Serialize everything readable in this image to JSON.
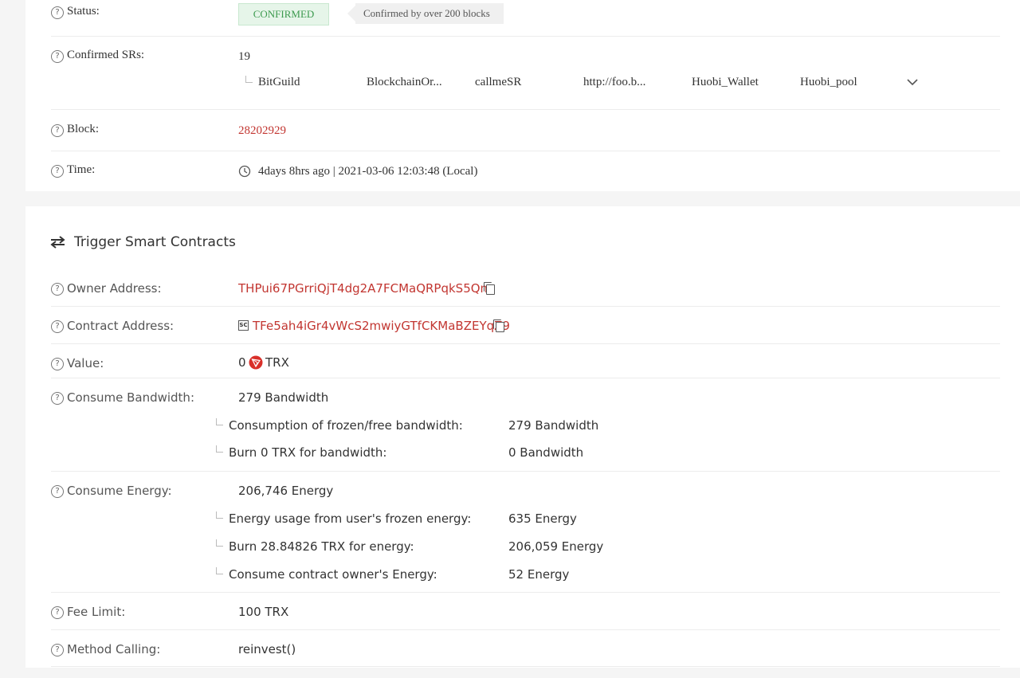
{
  "overview": {
    "status": {
      "label": "Status:",
      "badge": "CONFIRMED",
      "tip": "Confirmed by over 200 blocks"
    },
    "confirmed_srs": {
      "label": "Confirmed SRs:",
      "count": "19",
      "names": [
        "BitGuild",
        "BlockchainOr...",
        "callmeSR",
        "http://foo.b...",
        "Huobi_Wallet",
        "Huobi_pool"
      ]
    },
    "block": {
      "label": "Block:",
      "value": "28202929"
    },
    "time": {
      "label": "Time:",
      "value": "4days 8hrs ago | 2021-03-06 12:03:48 (Local)"
    }
  },
  "contract": {
    "title": "Trigger Smart Contracts",
    "owner_address": {
      "label": "Owner Address:",
      "value": "THPui67PGrriQjT4dg2A7FCMaQRPqkS5Qm"
    },
    "contract_address": {
      "label": "Contract Address:",
      "badge": "SC",
      "value": "TFe5ah4iGr4vWcS2mwiyGTfCKMaBZEYqZ9"
    },
    "value": {
      "label": "Value:",
      "amount": "0",
      "unit": "TRX"
    },
    "bandwidth": {
      "label": "Consume Bandwidth:",
      "value": "279 Bandwidth",
      "items": [
        {
          "label": "Consumption of frozen/free bandwidth:",
          "value": "279 Bandwidth"
        },
        {
          "label": "Burn 0 TRX for bandwidth:",
          "value": "0 Bandwidth"
        }
      ]
    },
    "energy": {
      "label": "Consume Energy:",
      "value": "206,746 Energy",
      "items": [
        {
          "label": "Energy usage from user's frozen energy:",
          "value": "635 Energy"
        },
        {
          "label": "Burn 28.84826 TRX for energy:",
          "value": "206,059 Energy"
        },
        {
          "label": "Consume contract owner's Energy:",
          "value": "52 Energy"
        }
      ]
    },
    "fee_limit": {
      "label": "Fee Limit:",
      "value": "100 TRX"
    },
    "method": {
      "label": "Method Calling:",
      "value": "reinvest()"
    }
  },
  "colors": {
    "link": "#c23631",
    "confirmed_bg": "#e6f5e9",
    "confirmed_text": "#3c9a4e",
    "trx": "#d9302a"
  },
  "icons": [
    "help-icon",
    "clock-icon",
    "transfer-arrows-icon",
    "copy-icon",
    "chevron-down-icon",
    "trx-icon"
  ]
}
